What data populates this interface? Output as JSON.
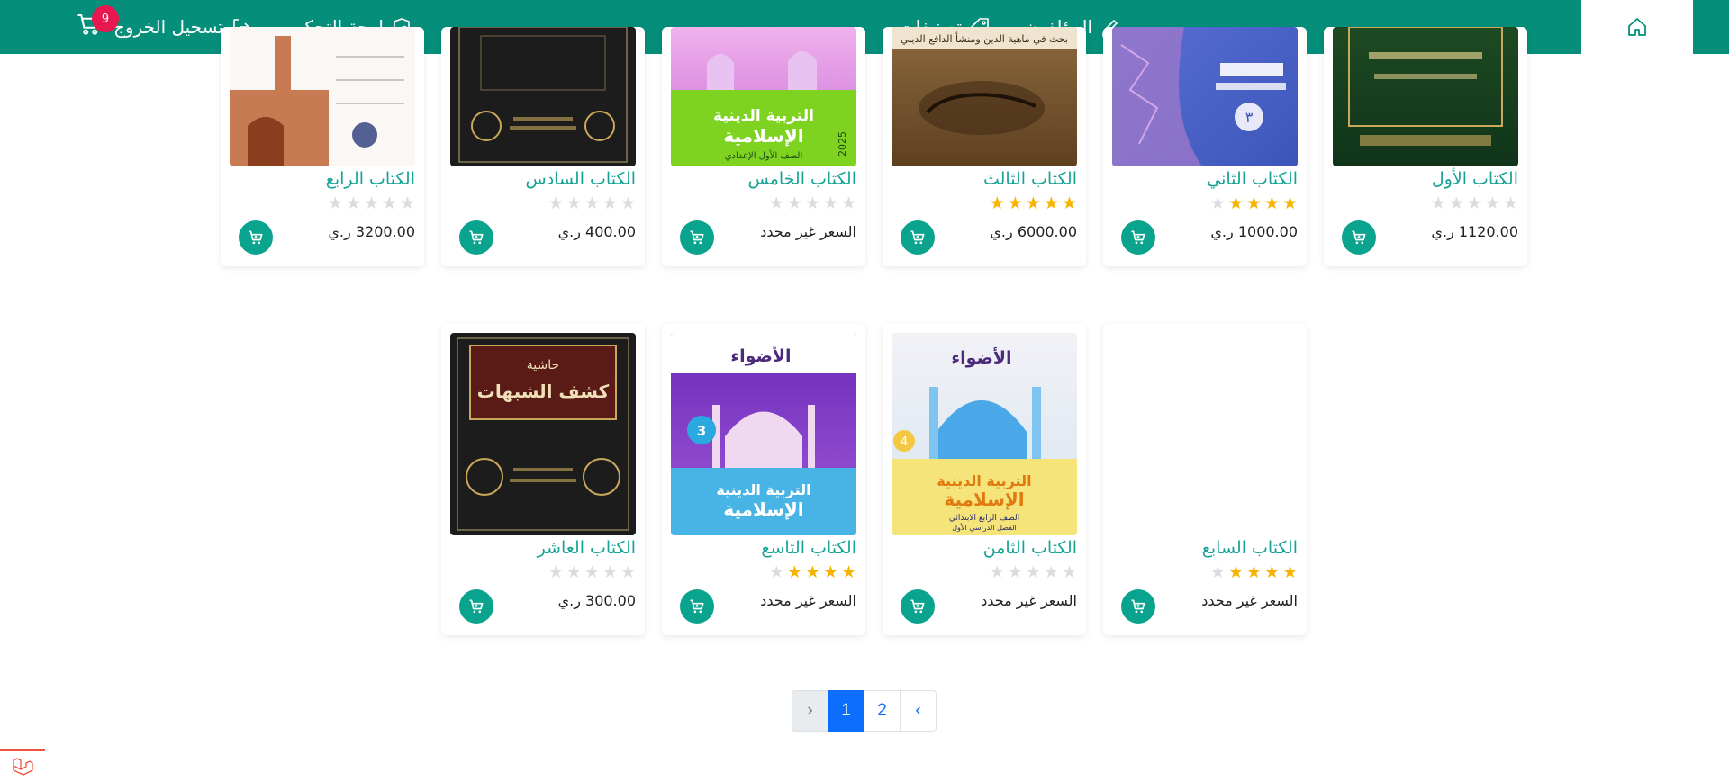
{
  "nav": {
    "home_icon": "home-icon",
    "authors": "المؤلفون",
    "categories": "تصنيفات",
    "dashboard": "لوحة التحكم",
    "logout": "تسحيل الخروج",
    "cart_count": "9",
    "accent_color": "#058f7b"
  },
  "books": [
    {
      "title": "الكتاب الأول",
      "rating": 0,
      "price": "1120.00 ر.ي",
      "cover": "dark-green-cover"
    },
    {
      "title": "الكتاب الثاني",
      "rating": 4,
      "price": "1000.00 ر.ي",
      "cover": "blue-geometric-cover"
    },
    {
      "title": "الكتاب الثالث",
      "rating": 5,
      "price": "6000.00 ر.ي",
      "cover": "cave-painting-cover"
    },
    {
      "title": "الكتاب الخامس",
      "rating": 0,
      "price": "السعر غير محدد",
      "cover": "purple-mosque-cover"
    },
    {
      "title": "الكتاب السادس",
      "rating": 0,
      "price": "400.00 ر.ي",
      "cover": "black-ornate-cover"
    },
    {
      "title": "الكتاب الرابع",
      "rating": 0,
      "price": "3200.00 ر.ي",
      "cover": "minaret-form-cover"
    },
    {
      "title": "الكتاب السابع",
      "rating": 4,
      "price": "السعر غير محدد",
      "cover": "blank-cover"
    },
    {
      "title": "الكتاب الثامن",
      "rating": 0,
      "price": "السعر غير محدد",
      "cover": "blue-mosque-cover"
    },
    {
      "title": "الكتاب التاسع",
      "rating": 4,
      "price": "السعر غير محدد",
      "cover": "pink-mosque-cover"
    },
    {
      "title": "الكتاب العاشر",
      "rating": 0,
      "price": "300.00 ر.ي",
      "cover": "black-ornate-cover"
    }
  ],
  "cover_texts": {
    "publisher": "الأضواء",
    "subject_line1": "التربية الدينية",
    "subject_line2": "الإسلامية",
    "grade_first": "الصف الأول الإعدادي",
    "grade_fourth": "الصف الرابع الابتدائي",
    "term_first": "الفصل الدراسي الأول",
    "year": "2025",
    "num_3": "3",
    "num_4": "4",
    "cave_heading": "بحث في ماهية الدين ومنشأ الدافع الديني",
    "hashiya_title": "حاشية",
    "hashiya_name": "كشف الشبهات"
  },
  "pagination": {
    "prev": "‹",
    "pages": [
      "1",
      "2"
    ],
    "next": "›",
    "current": "1"
  }
}
